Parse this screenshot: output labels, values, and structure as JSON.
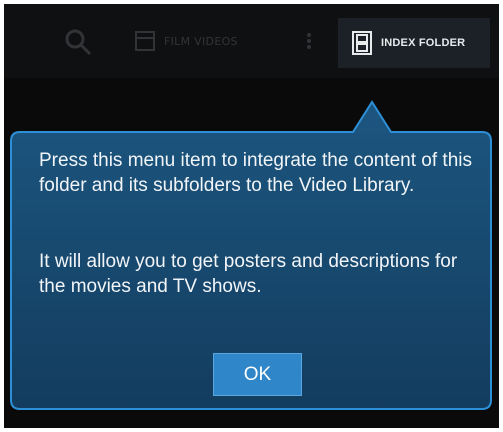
{
  "action_bar": {
    "folder_label": "FILM VIDEOS",
    "index_folder_label": "INDEX FOLDER",
    "icons": [
      "search-icon",
      "folder-icon",
      "more-icon",
      "film-strip-icon"
    ]
  },
  "callout": {
    "paragraph_1": "Press this menu item to integrate the content of this folder and its subfolders to the Video Library.",
    "paragraph_2": "It will allow you to get posters and descriptions for the movies and TV shows.",
    "ok_label": "OK"
  },
  "colors": {
    "background": "#0a0a0b",
    "callout_fill": "#17456a",
    "callout_border": "#2d8fd6",
    "button": "#2f86c9",
    "text": "#f2f5f8"
  }
}
